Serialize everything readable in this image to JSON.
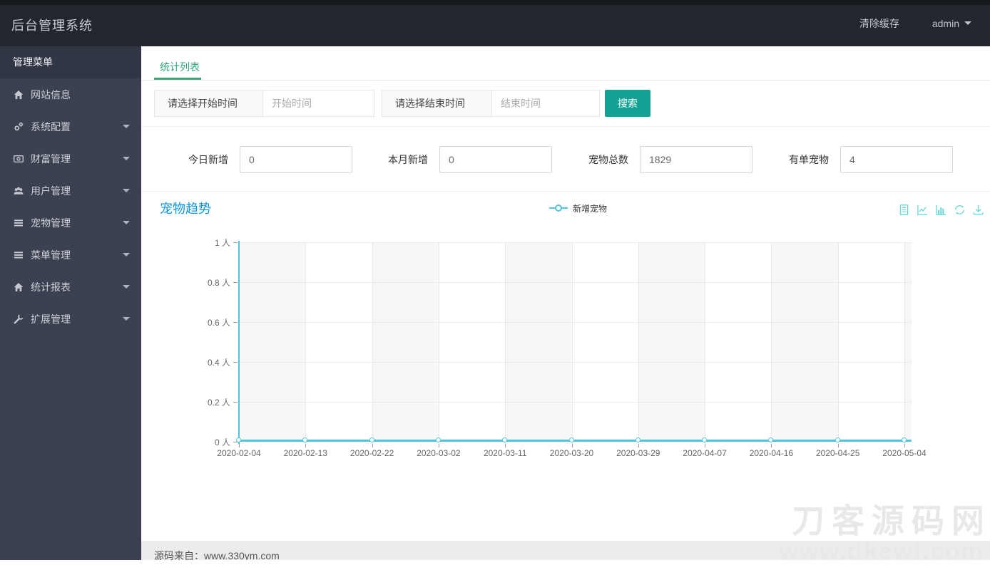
{
  "header": {
    "title": "后台管理系统",
    "clear_cache_label": "清除缓存",
    "username": "admin"
  },
  "sidebar": {
    "heading": "管理菜单",
    "items": [
      {
        "icon": "home-icon",
        "label": "网站信息",
        "expandable": false
      },
      {
        "icon": "gears-icon",
        "label": "系统配置",
        "expandable": true
      },
      {
        "icon": "money-icon",
        "label": "财富管理",
        "expandable": true
      },
      {
        "icon": "users-icon",
        "label": "用户管理",
        "expandable": true
      },
      {
        "icon": "list-icon",
        "label": "宠物管理",
        "expandable": true
      },
      {
        "icon": "list-icon",
        "label": "菜单管理",
        "expandable": true
      },
      {
        "icon": "home-icon",
        "label": "统计报表",
        "expandable": true
      },
      {
        "icon": "wrench-icon",
        "label": "扩展管理",
        "expandable": true
      }
    ]
  },
  "tab": {
    "active_label": "统计列表"
  },
  "filters": {
    "start_label": "请选择开始时间",
    "start_placeholder": "开始时间",
    "end_label": "请选择结束时间",
    "end_placeholder": "结束时间",
    "search_label": "搜索"
  },
  "stats": {
    "fields": [
      {
        "label": "今日新增",
        "value": "0"
      },
      {
        "label": "本月新增",
        "value": "0"
      },
      {
        "label": "宠物总数",
        "value": "1829"
      },
      {
        "label": "有单宠物",
        "value": "4"
      }
    ]
  },
  "chart": {
    "title": "宠物趋势",
    "legend_label": "新增宠物",
    "toolbox_icons": [
      "data-view-icon",
      "line-chart-icon",
      "bar-chart-icon",
      "restore-icon",
      "save-image-icon"
    ]
  },
  "chart_data": {
    "type": "line",
    "title": "宠物趋势",
    "x": [
      "2020-02-04",
      "2020-02-13",
      "2020-02-22",
      "2020-03-02",
      "2020-03-11",
      "2020-03-20",
      "2020-03-29",
      "2020-04-07",
      "2020-04-16",
      "2020-04-25",
      "2020-05-04"
    ],
    "series": [
      {
        "name": "新增宠物",
        "values": [
          0,
          0,
          0,
          0,
          0,
          0,
          0,
          0,
          0,
          0,
          0
        ]
      }
    ],
    "yticks_labels": [
      "1 人",
      "0.8 人",
      "0.6 人",
      "0.4 人",
      "0.2 人",
      "0 人"
    ],
    "ylim": [
      0,
      1
    ],
    "y_unit": "人",
    "grid": true,
    "split_area_alternating": true,
    "legend_position": "top-center"
  },
  "footer": {
    "text": "源码来自：www.330ym.com"
  },
  "watermark": {
    "line1": "刀客源码网",
    "line2": "www.dkewl.com"
  },
  "colors": {
    "header_bg": "#23262E",
    "sidebar_bg": "#3B4150",
    "sidebar_heading_bg": "#303644",
    "accent_teal": "#14A294",
    "tab_green": "#2FA779",
    "tab_underline_green": "#41A376",
    "chart_title_blue": "#1296DB",
    "series_cyan": "#55C3DA",
    "toolbox_cyan": "#69D5D3",
    "watermark_gray": "#E8E8E8",
    "footer_bg": "#ECECEC"
  }
}
